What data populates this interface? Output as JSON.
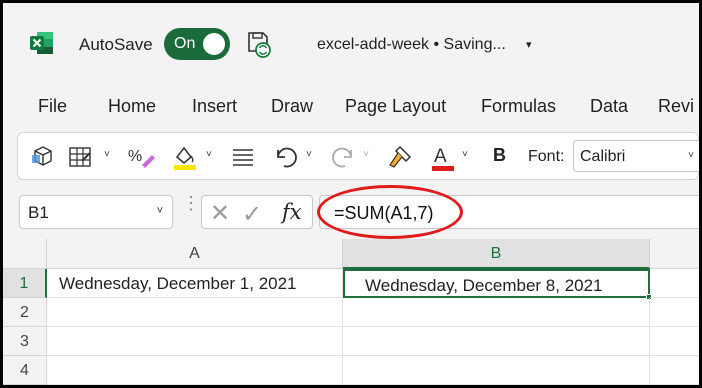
{
  "titlebar": {
    "autosave_label": "AutoSave",
    "toggle_state": "On",
    "file_title": "excel-add-week • Saving...",
    "title_caret": "▾"
  },
  "menu": {
    "tabs": [
      "File",
      "Home",
      "Insert",
      "Draw",
      "Page Layout",
      "Formulas",
      "Data",
      "Revi"
    ]
  },
  "ribbon": {
    "bold_label": "B",
    "font_label": "Font:",
    "font_value": "Calibri",
    "caret": "˅",
    "font_color": "#e01b1b",
    "highlight_color": "#ffe600"
  },
  "formula_bar": {
    "name_box": "B1",
    "formula": "=SUM(A1,7)",
    "cancel_glyph": "✕",
    "enter_glyph": "✓",
    "fx_label": "fx",
    "dots": "⋮"
  },
  "grid": {
    "columns": [
      "A",
      "B"
    ],
    "rows": [
      "1",
      "2",
      "3",
      "4"
    ],
    "cells": {
      "A1": "Wednesday, December 1, 2021",
      "B1": "Wednesday, December 8, 2021"
    },
    "active_cell": "B1"
  },
  "colors": {
    "excel_green": "#1e6e3e",
    "toggle_green": "#1b6b3a",
    "annotation_red": "#e01b1b"
  }
}
